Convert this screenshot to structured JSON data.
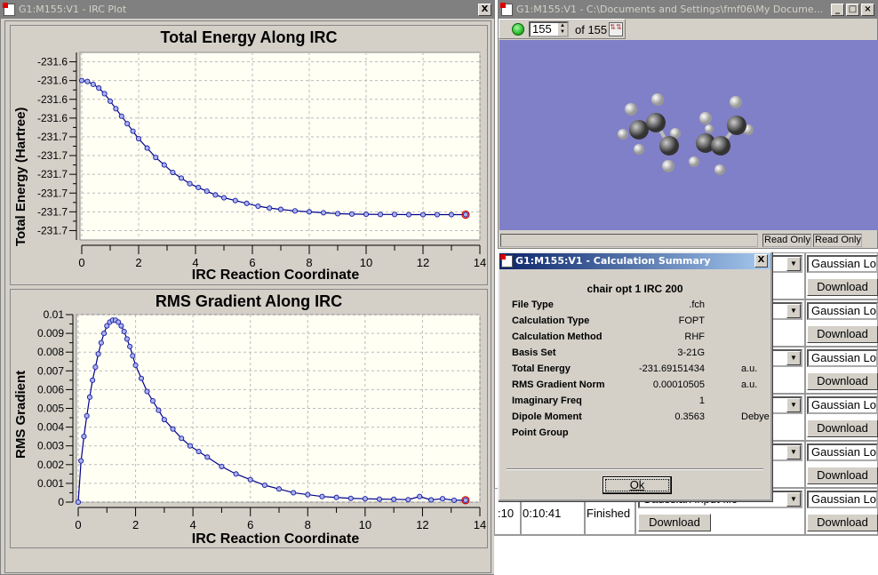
{
  "irc_window": {
    "title": "G1:M155:V1 - IRC Plot",
    "close": "X"
  },
  "chart_data": [
    {
      "type": "scatter",
      "title": "Total Energy Along IRC",
      "xlabel": "IRC Reaction Coordinate",
      "ylabel": "Total Energy (Hartree)",
      "xlim": [
        0,
        14
      ],
      "ylim": [
        -231.705,
        -231.605
      ],
      "xticks": [
        "0",
        "2",
        "4",
        "6",
        "8",
        "10",
        "12",
        "14"
      ],
      "yticks": [
        {
          "v": -231.61,
          "label": "-231.6"
        },
        {
          "v": -231.62,
          "label": "-231.6"
        },
        {
          "v": -231.63,
          "label": "-231.6"
        },
        {
          "v": -231.64,
          "label": "-231.6"
        },
        {
          "v": -231.65,
          "label": "-231.7"
        },
        {
          "v": -231.66,
          "label": "-231.7"
        },
        {
          "v": -231.67,
          "label": "-231.7"
        },
        {
          "v": -231.68,
          "label": "-231.7"
        },
        {
          "v": -231.69,
          "label": "-231.7"
        },
        {
          "v": -231.7,
          "label": "-231.7"
        }
      ],
      "grid": true,
      "x": [
        0,
        0.2,
        0.4,
        0.6,
        0.8,
        1.0,
        1.2,
        1.4,
        1.6,
        1.8,
        2.0,
        2.3,
        2.6,
        2.9,
        3.2,
        3.5,
        3.8,
        4.1,
        4.4,
        4.7,
        5.0,
        5.4,
        5.8,
        6.2,
        6.6,
        7.0,
        7.5,
        8.0,
        8.5,
        9.0,
        9.5,
        10.0,
        10.5,
        11.0,
        11.5,
        12.0,
        12.5,
        13.0,
        13.5
      ],
      "y": [
        -231.62,
        -231.6205,
        -231.622,
        -231.624,
        -231.627,
        -231.631,
        -231.635,
        -231.639,
        -231.643,
        -231.647,
        -231.651,
        -231.656,
        -231.661,
        -231.665,
        -231.669,
        -231.672,
        -231.675,
        -231.677,
        -231.679,
        -231.681,
        -231.6825,
        -231.684,
        -231.6855,
        -231.687,
        -231.688,
        -231.6887,
        -231.6895,
        -231.69,
        -231.6905,
        -231.691,
        -231.6912,
        -231.6913,
        -231.6914,
        -231.6914,
        -231.6915,
        -231.6915,
        -231.6915,
        -231.6915,
        -231.6915
      ]
    },
    {
      "type": "scatter",
      "title": "RMS Gradient Along IRC",
      "xlabel": "IRC Reaction Coordinate",
      "ylabel": "RMS Gradient",
      "xlim": [
        0,
        14
      ],
      "ylim": [
        0,
        0.01
      ],
      "xticks": [
        "0",
        "2",
        "4",
        "6",
        "8",
        "10",
        "12",
        "14"
      ],
      "yticks": [
        {
          "v": 0,
          "label": "0"
        },
        {
          "v": 0.001,
          "label": "0.001"
        },
        {
          "v": 0.002,
          "label": "0.002"
        },
        {
          "v": 0.003,
          "label": "0.003"
        },
        {
          "v": 0.004,
          "label": "0.004"
        },
        {
          "v": 0.005,
          "label": "0.005"
        },
        {
          "v": 0.006,
          "label": "0.006"
        },
        {
          "v": 0.007,
          "label": "0.007"
        },
        {
          "v": 0.008,
          "label": "0.008"
        },
        {
          "v": 0.009,
          "label": "0.009"
        },
        {
          "v": 0.01,
          "label": "0.01"
        }
      ],
      "grid": true,
      "x": [
        0,
        0.1,
        0.2,
        0.3,
        0.4,
        0.5,
        0.6,
        0.7,
        0.8,
        0.9,
        1.0,
        1.1,
        1.2,
        1.3,
        1.4,
        1.5,
        1.6,
        1.7,
        1.8,
        1.9,
        2.0,
        2.2,
        2.4,
        2.6,
        2.8,
        3.0,
        3.3,
        3.6,
        3.9,
        4.2,
        4.5,
        5.0,
        5.5,
        6.0,
        6.5,
        7.0,
        7.5,
        8.0,
        8.5,
        9.0,
        9.5,
        10.0,
        10.5,
        11.0,
        11.5,
        11.9,
        12.3,
        12.7,
        13.1,
        13.5
      ],
      "y": [
        0,
        0.0022,
        0.0035,
        0.0046,
        0.0056,
        0.0065,
        0.0072,
        0.0079,
        0.0085,
        0.009,
        0.0094,
        0.0096,
        0.0097,
        0.0097,
        0.0096,
        0.0094,
        0.0091,
        0.0087,
        0.0083,
        0.0078,
        0.0073,
        0.0066,
        0.0059,
        0.0054,
        0.0049,
        0.0044,
        0.0039,
        0.0034,
        0.003,
        0.0027,
        0.0024,
        0.0019,
        0.0015,
        0.0012,
        0.0009,
        0.0007,
        0.0005,
        0.0004,
        0.0003,
        0.00025,
        0.0002,
        0.00018,
        0.00016,
        0.00015,
        0.00013,
        0.0003,
        0.00012,
        0.00018,
        0.0001,
        0.0001
      ]
    }
  ],
  "viewer_window": {
    "title": "G1:M155:V1 - C:\\Documents and Settings\\fmf06\\My Docume...",
    "frame_value": "155",
    "of_label": "of 155",
    "status": [
      "Read Only",
      "Read Only"
    ],
    "viewport_color": "#8080c8"
  },
  "dialog": {
    "title": "G1:M155:V1 - Calculation Summary",
    "close": "X",
    "heading": "chair opt 1 IRC 200",
    "rows": [
      {
        "k": "File Type",
        "v": ".fch",
        "u": ""
      },
      {
        "k": "Calculation Type",
        "v": "FOPT",
        "u": ""
      },
      {
        "k": "Calculation Method",
        "v": "RHF",
        "u": ""
      },
      {
        "k": "Basis Set",
        "v": "3-21G",
        "u": ""
      },
      {
        "k": "Total Energy",
        "v": "-231.69151434",
        "u": "a.u."
      },
      {
        "k": "RMS Gradient Norm",
        "v": "0.00010505",
        "u": "a.u."
      },
      {
        "k": "Imaginary Freq",
        "v": "1",
        "u": ""
      },
      {
        "k": "Dipole Moment",
        "v": "0.3563",
        "u": "Debye"
      },
      {
        "k": "Point Group",
        "v": "",
        "u": ""
      }
    ],
    "ok": "Ok"
  },
  "jobs": {
    "right_select": "Gaussian Lo",
    "download": "Download",
    "last_row": {
      "c1": ":10",
      "c2": "0:10:41",
      "status": "Finished",
      "select": "Gaussian input file"
    }
  }
}
